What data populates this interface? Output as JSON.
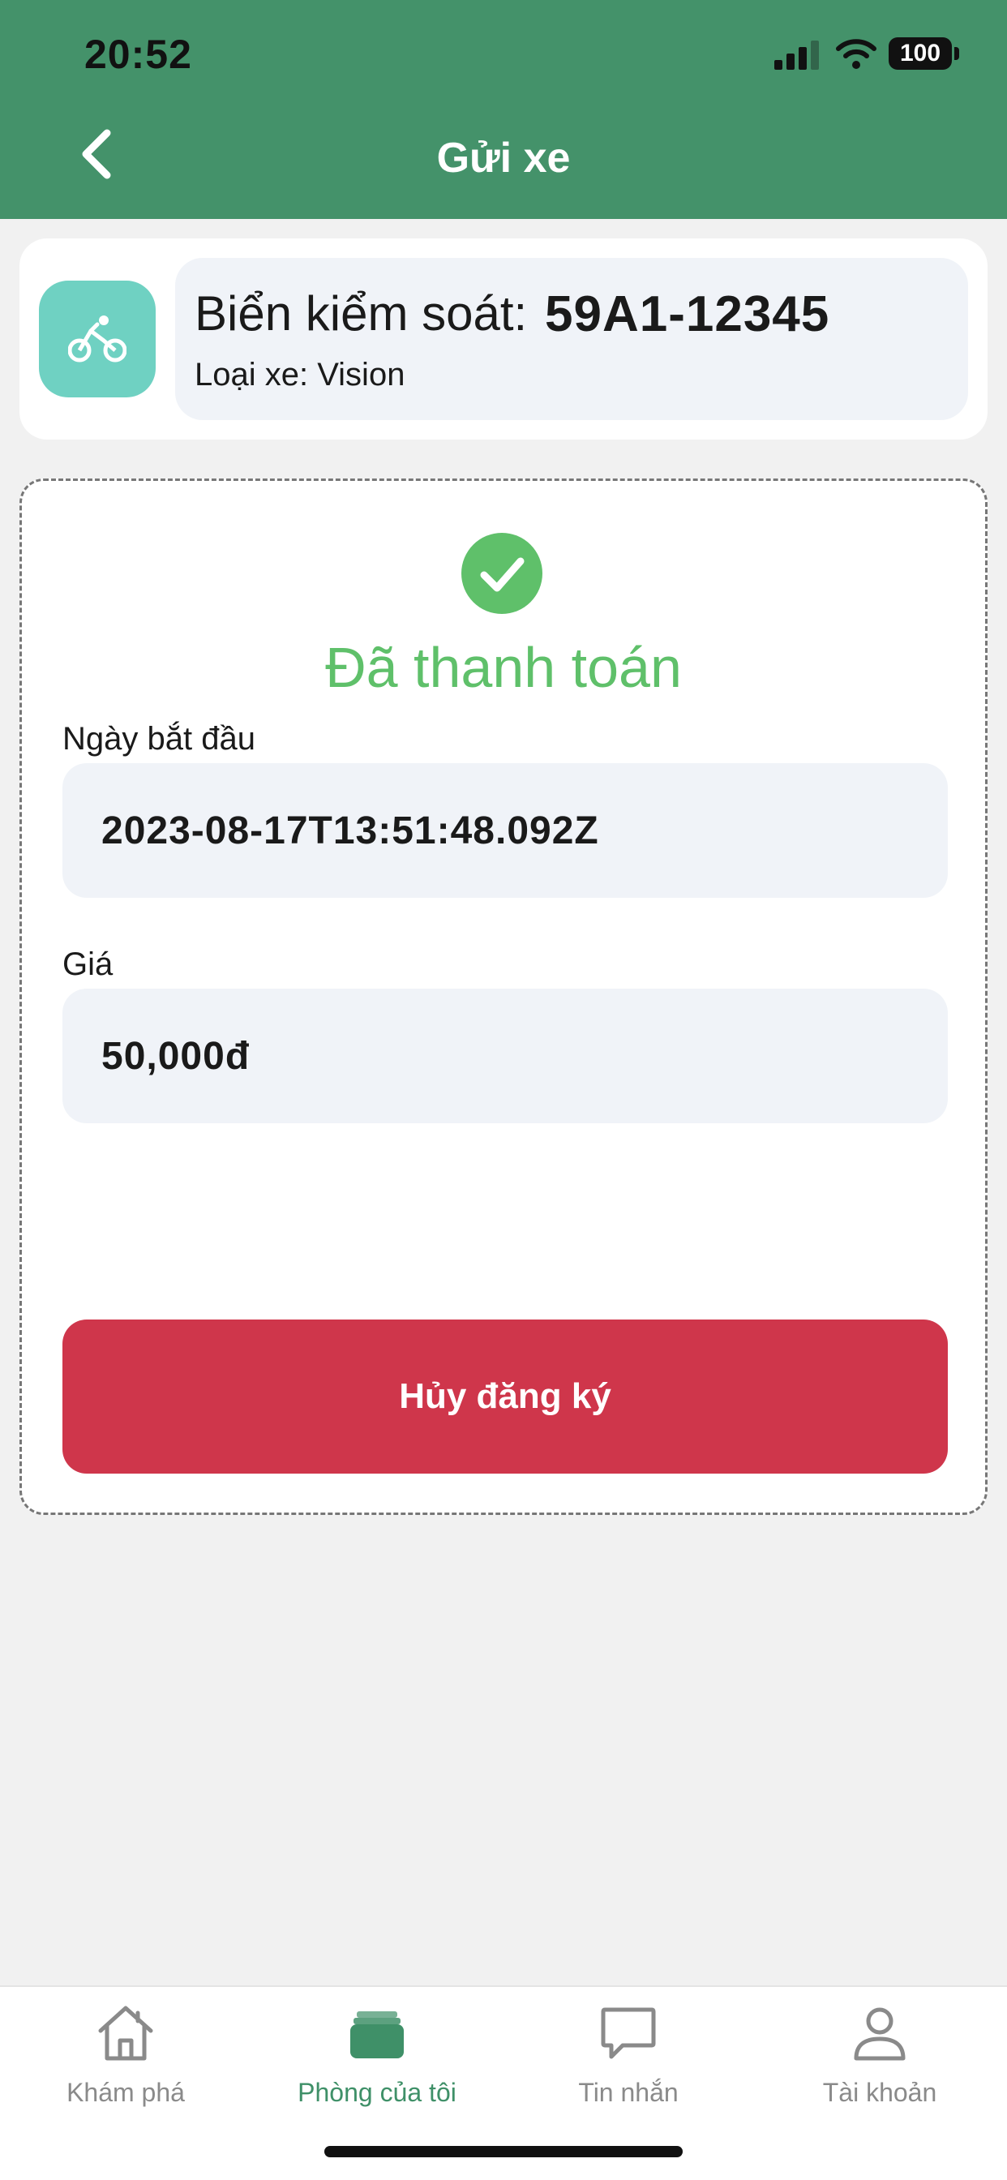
{
  "status_bar": {
    "time": "20:52",
    "battery": "100"
  },
  "header": {
    "title": "Gửi xe",
    "back_icon": "chevron-left-icon"
  },
  "vehicle": {
    "icon": "bicycle-icon",
    "plate_label": "Biển kiểm soát:",
    "plate_value": "59A1-12345",
    "type_text": "Loại xe: Vision"
  },
  "payment": {
    "status": "Đã thanh toán",
    "status_color": "#5fc06a",
    "start_date_label": "Ngày bắt đầu",
    "start_date_value": "2023-08-17T13:51:48.092Z",
    "price_label": "Giá",
    "price_value": "50,000đ",
    "cancel_label": "Hủy đăng ký",
    "cancel_color": "#cf364b"
  },
  "tabs": [
    {
      "label": "Khám phá",
      "icon": "home-icon",
      "active": false
    },
    {
      "label": "Phòng của tôi",
      "icon": "wallet-icon",
      "active": true
    },
    {
      "label": "Tin nhắn",
      "icon": "chat-bubble-icon",
      "active": false
    },
    {
      "label": "Tài khoản",
      "icon": "user-icon",
      "active": false
    }
  ],
  "colors": {
    "header_bg": "#44926a",
    "active_tab": "#3f9068"
  }
}
